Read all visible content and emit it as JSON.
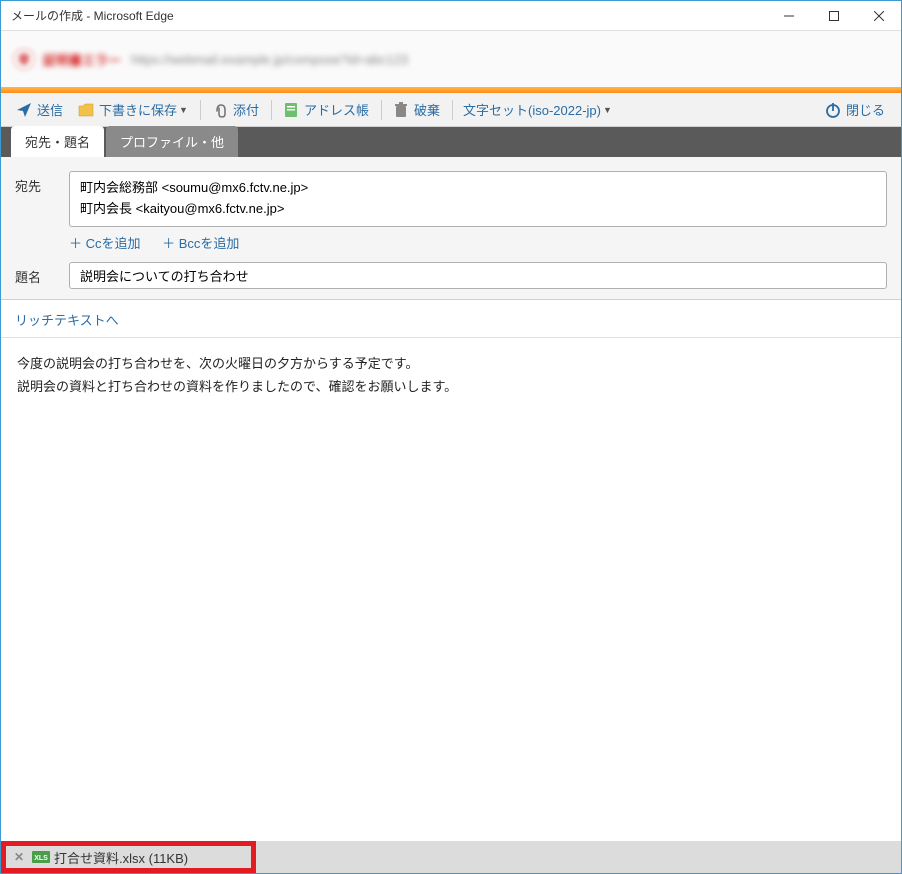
{
  "window": {
    "title": "メールの作成 - Microsoft Edge"
  },
  "banner": {
    "badge_icon": "shield-icon",
    "text1": "証明書エラー",
    "text2": "https://webmail.example.jp/compose?id=abc123"
  },
  "toolbar": {
    "send": "送信",
    "save_draft": "下書きに保存",
    "attach": "添付",
    "addressbook": "アドレス帳",
    "discard": "破棄",
    "charset_label": "文字セット(iso-2022-jp)",
    "close": "閉じる"
  },
  "tabs": [
    {
      "label": "宛先・題名",
      "active": true
    },
    {
      "label": "プロファイル・他",
      "active": false
    }
  ],
  "form": {
    "to_label": "宛先",
    "recipients": [
      "町内会総務部 <soumu@mx6.fctv.ne.jp>",
      "町内会長 <kaityou@mx6.fctv.ne.jp>"
    ],
    "add_cc": "＋ Ccを追加",
    "add_bcc": "＋ Bccを追加",
    "subject_label": "題名",
    "subject_value": "説明会についての打ち合わせ"
  },
  "richtext_link": "リッチテキストへ",
  "body_lines": [
    "今度の説明会の打ち合わせを、次の火曜日の夕方からする予定です。",
    "説明会の資料と打ち合わせの資料を作りましたので、確認をお願いします。"
  ],
  "attachment": {
    "filename": "打合せ資料.xlsx (11KB)"
  }
}
